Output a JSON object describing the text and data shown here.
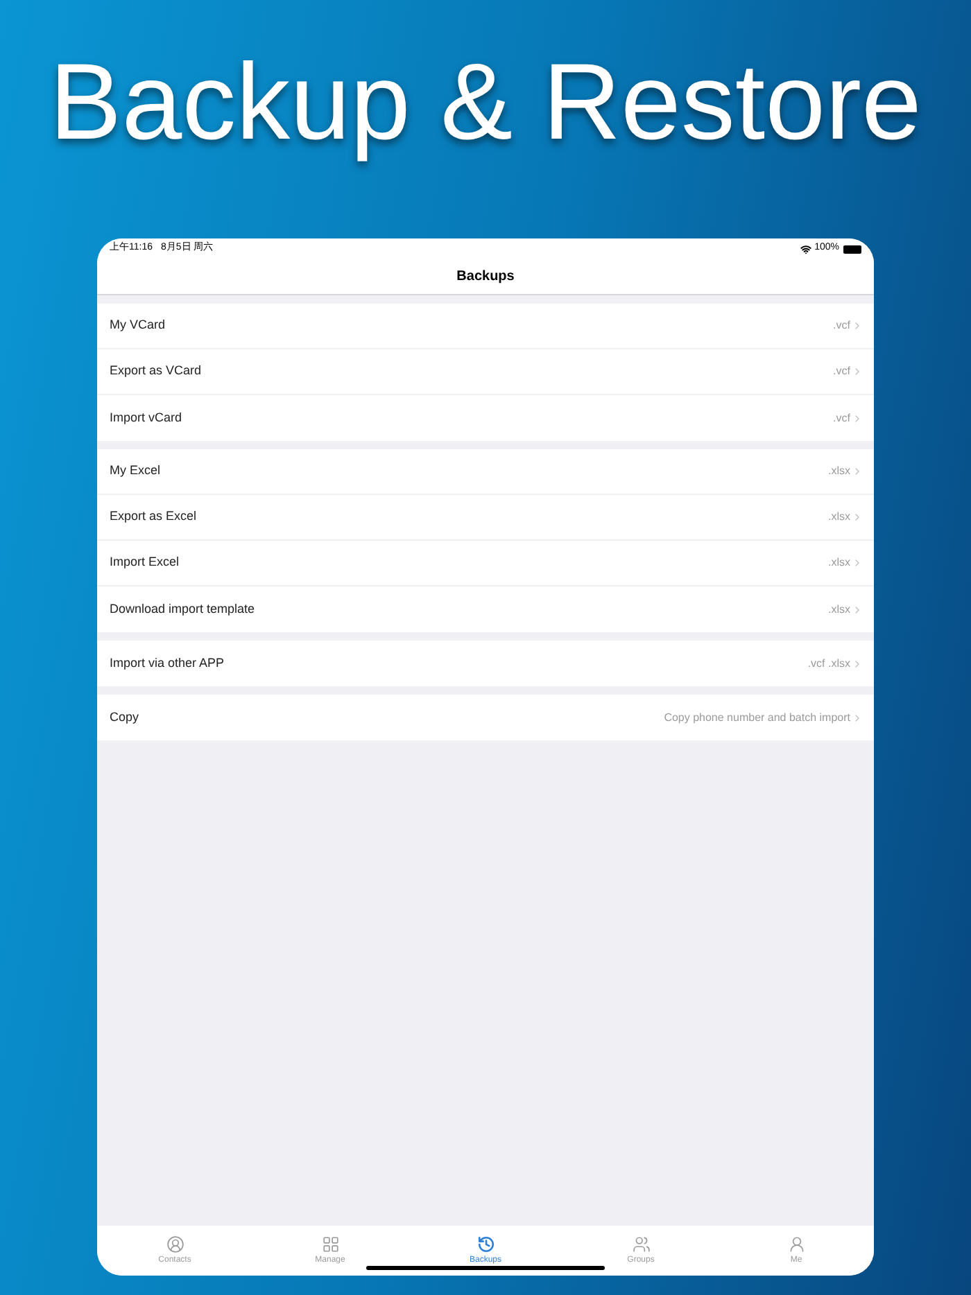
{
  "headline": "Backup & Restore",
  "status_bar": {
    "time": "上午11:16",
    "date": "8月5日 周六",
    "battery": "100%"
  },
  "nav": {
    "title": "Backups"
  },
  "sections": [
    {
      "rows": [
        {
          "label": "My VCard",
          "detail": ".vcf"
        },
        {
          "label": "Export as VCard",
          "detail": ".vcf"
        },
        {
          "label": "Import vCard",
          "detail": ".vcf"
        }
      ]
    },
    {
      "rows": [
        {
          "label": "My Excel",
          "detail": ".xlsx"
        },
        {
          "label": "Export as Excel",
          "detail": ".xlsx"
        },
        {
          "label": "Import Excel",
          "detail": ".xlsx"
        },
        {
          "label": "Download import template",
          "detail": ".xlsx"
        }
      ]
    },
    {
      "rows": [
        {
          "label": "Import via other APP",
          "detail": ".vcf .xlsx"
        }
      ]
    },
    {
      "rows": [
        {
          "label": "Copy",
          "detail": "Copy phone number and batch import"
        }
      ]
    }
  ],
  "tabs": [
    {
      "kind": "contacts",
      "label": "Contacts",
      "selected": false
    },
    {
      "kind": "manage",
      "label": "Manage",
      "selected": false
    },
    {
      "kind": "backups",
      "label": "Backups",
      "selected": true
    },
    {
      "kind": "groups",
      "label": "Groups",
      "selected": false
    },
    {
      "kind": "me",
      "label": "Me",
      "selected": false
    }
  ]
}
